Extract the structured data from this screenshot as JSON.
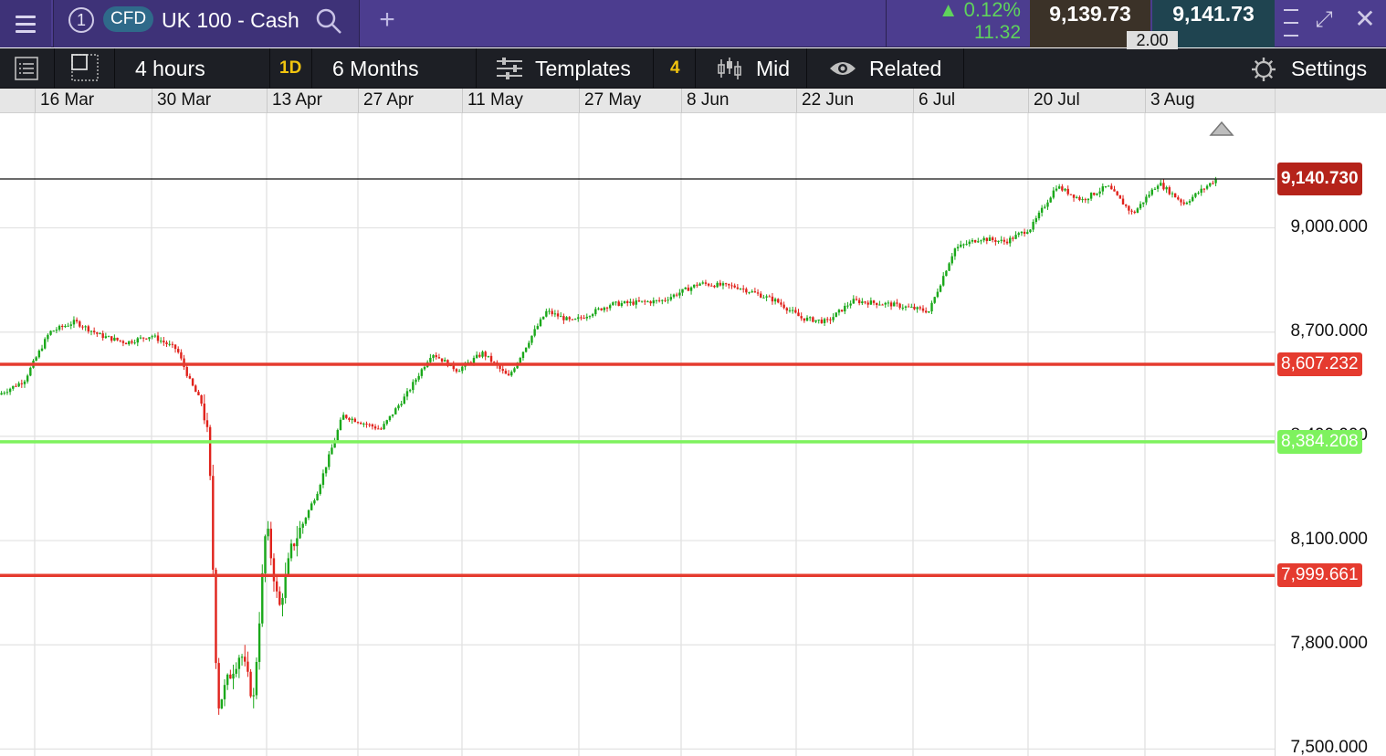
{
  "topbar": {
    "tab_number": "1",
    "instrument_type": "CFD",
    "instrument_name": "UK 100 - Cash",
    "change_percent": "0.12%",
    "change_points": "11.32",
    "sell_price": "9,139.73",
    "buy_price": "9,141.73",
    "spread": "2.00",
    "colors": {
      "up": "#5fd35c",
      "header": "#4c3d8f"
    }
  },
  "toolbar": {
    "interval": "4 hours",
    "timeframe_badge": "1D",
    "range": "6 Months",
    "templates_label": "Templates",
    "indicator_count": "4",
    "price_type": "Mid",
    "related_label": "Related",
    "settings_label": "Settings"
  },
  "chart_data": {
    "type": "candlestick",
    "x_labels": [
      "16 Mar",
      "30 Mar",
      "13 Apr",
      "27 Apr",
      "11 May",
      "27 May",
      "8 Jun",
      "22 Jun",
      "6 Jul",
      "20 Jul",
      "3 Aug"
    ],
    "y_ticks": [
      "9,000.000",
      "8,700.000",
      "8,400.000",
      "8,100.000",
      "7,800.000",
      "7,500.000"
    ],
    "ylim": [
      7480,
      9330
    ],
    "current_price": "9,140.730",
    "horizontal_lines": [
      {
        "value": 8607.232,
        "label": "8,607.232",
        "color": "#e53b2f"
      },
      {
        "value": 8384.208,
        "label": "8,384.208",
        "color": "#7ef25e"
      },
      {
        "value": 7999.661,
        "label": "7,999.661",
        "color": "#e53b2f"
      }
    ],
    "price_path": [
      [
        0,
        8520
      ],
      [
        0.02,
        8560
      ],
      [
        0.04,
        8700
      ],
      [
        0.06,
        8730
      ],
      [
        0.08,
        8690
      ],
      [
        0.1,
        8670
      ],
      [
        0.12,
        8690
      ],
      [
        0.14,
        8650
      ],
      [
        0.15,
        8560
      ],
      [
        0.16,
        8490
      ],
      [
        0.165,
        8380
      ],
      [
        0.168,
        8050
      ],
      [
        0.17,
        7820
      ],
      [
        0.172,
        7620
      ],
      [
        0.18,
        7700
      ],
      [
        0.19,
        7780
      ],
      [
        0.2,
        7640
      ],
      [
        0.21,
        8150
      ],
      [
        0.22,
        7900
      ],
      [
        0.23,
        8080
      ],
      [
        0.25,
        8240
      ],
      [
        0.27,
        8460
      ],
      [
        0.3,
        8420
      ],
      [
        0.32,
        8520
      ],
      [
        0.34,
        8640
      ],
      [
        0.36,
        8590
      ],
      [
        0.38,
        8640
      ],
      [
        0.4,
        8570
      ],
      [
        0.42,
        8700
      ],
      [
        0.43,
        8760
      ],
      [
        0.45,
        8730
      ],
      [
        0.48,
        8780
      ],
      [
        0.52,
        8790
      ],
      [
        0.55,
        8840
      ],
      [
        0.58,
        8830
      ],
      [
        0.61,
        8790
      ],
      [
        0.63,
        8740
      ],
      [
        0.65,
        8730
      ],
      [
        0.67,
        8790
      ],
      [
        0.7,
        8780
      ],
      [
        0.73,
        8760
      ],
      [
        0.75,
        8940
      ],
      [
        0.77,
        8970
      ],
      [
        0.79,
        8960
      ],
      [
        0.81,
        9000
      ],
      [
        0.83,
        9120
      ],
      [
        0.85,
        9080
      ],
      [
        0.87,
        9120
      ],
      [
        0.89,
        9040
      ],
      [
        0.91,
        9130
      ],
      [
        0.93,
        9070
      ],
      [
        0.955,
        9140
      ]
    ],
    "colors": {
      "up": "#1aa81a",
      "down": "#e0221b"
    }
  }
}
